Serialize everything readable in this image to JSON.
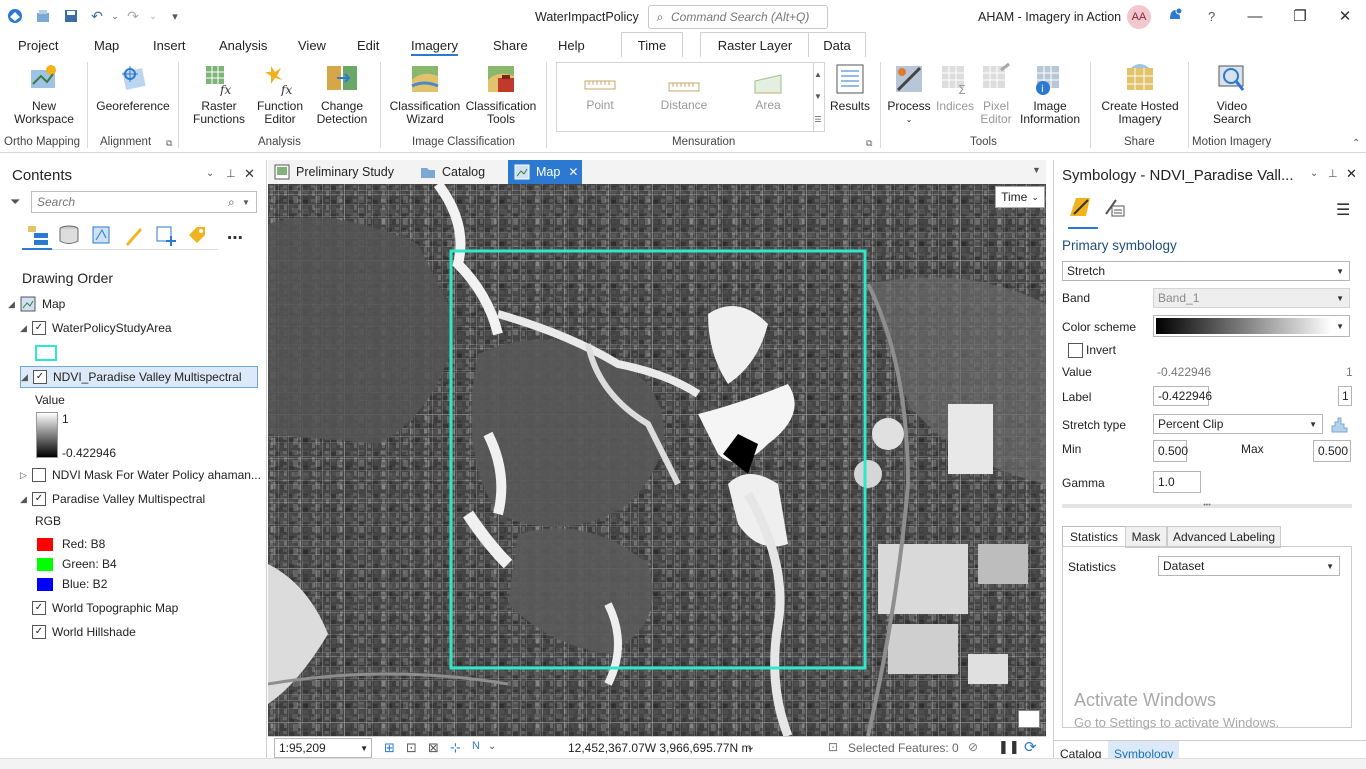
{
  "titlebar": {
    "project_name": "WaterImpactPolicy",
    "search_placeholder": "Command Search (Alt+Q)",
    "portal_title": "AHAM - Imagery in Action",
    "user_initials": "AA",
    "help_glyph": "?"
  },
  "ribbon_tabs": [
    "Project",
    "Map",
    "Insert",
    "Analysis",
    "View",
    "Edit",
    "Imagery",
    "Share",
    "Help"
  ],
  "context_tabs": [
    "Time",
    "Raster Layer",
    "Data"
  ],
  "ribbon": {
    "buttons": {
      "new_workspace": [
        "New",
        "Workspace"
      ],
      "georeference": "Georeference",
      "raster_functions": [
        "Raster",
        "Functions"
      ],
      "function_editor": [
        "Function",
        "Editor"
      ],
      "change_detection": [
        "Change",
        "Detection"
      ],
      "classification_wizard": [
        "Classification",
        "Wizard"
      ],
      "classification_tools": [
        "Classification",
        "Tools"
      ],
      "point": "Point",
      "distance": "Distance",
      "area": "Area",
      "results": "Results",
      "process": "Process",
      "indices": "Indices",
      "pixel_editor": [
        "Pixel",
        "Editor"
      ],
      "image_information": [
        "Image",
        "Information"
      ],
      "create_hosted_imagery": [
        "Create Hosted",
        "Imagery"
      ],
      "video_search": [
        "Video",
        "Search"
      ]
    },
    "groups": {
      "ortho_mapping": "Ortho Mapping",
      "alignment": "Alignment",
      "analysis": "Analysis",
      "image_classification": "Image Classification",
      "mensuration": "Mensuration",
      "tools": "Tools",
      "share": "Share",
      "motion_imagery": "Motion Imagery"
    }
  },
  "contents": {
    "title": "Contents",
    "search_placeholder": "Search",
    "drawing_order": "Drawing Order",
    "map": "Map",
    "layers": {
      "study_area": "WaterPolicyStudyArea",
      "ndvi": "NDVI_Paradise Valley Multispectral",
      "value_label": "Value",
      "value_max": "1",
      "value_min": "-0.422946",
      "ndvi_mask": "NDVI Mask For Water Policy ahaman...",
      "multispectral": "Paradise Valley Multispectral",
      "rgb_label": "RGB",
      "red": "Red:   B8",
      "green": "Green: B4",
      "blue": "Blue:  B2",
      "topo": "World Topographic Map",
      "hillshade": "World Hillshade"
    }
  },
  "view_tabs": [
    "Preliminary Study",
    "Catalog",
    "Map"
  ],
  "map": {
    "time_button": "Time",
    "scale": "1:95,209",
    "coordinates": "12,452,367.07W 3,966,695.77N m",
    "selected_features": "Selected Features: 0"
  },
  "symbology": {
    "title": "Symbology - NDVI_Paradise Vall...",
    "primary_symbology": "Primary symbology",
    "renderer": "Stretch",
    "band_label": "Band",
    "band_value": "Band_1",
    "color_scheme_label": "Color scheme",
    "invert_label": "Invert",
    "value_label": "Value",
    "value_value": "-0.422946",
    "value_index": "1",
    "label_label": "Label",
    "label_value": "-0.422946",
    "label_index": "1",
    "stretch_type_label": "Stretch type",
    "stretch_type_value": "Percent Clip",
    "min_label": "Min",
    "min_value": "0.500",
    "max_label": "Max",
    "max_value": "0.500",
    "gamma_label": "Gamma",
    "gamma_value": "1.0",
    "subtabs": [
      "Statistics",
      "Mask",
      "Advanced Labeling"
    ],
    "statistics_label": "Statistics",
    "statistics_value": "Dataset"
  },
  "bottom_tabs": [
    "Catalog",
    "Symbology"
  ],
  "watermark": {
    "line1": "Activate Windows",
    "line2": "Go to Settings to activate Windows."
  },
  "colors": {
    "accent": "#2b79d0",
    "study_area_outline": "#2ee8c8",
    "red": "#ff0000",
    "green": "#00ff00",
    "blue": "#0000ff"
  }
}
